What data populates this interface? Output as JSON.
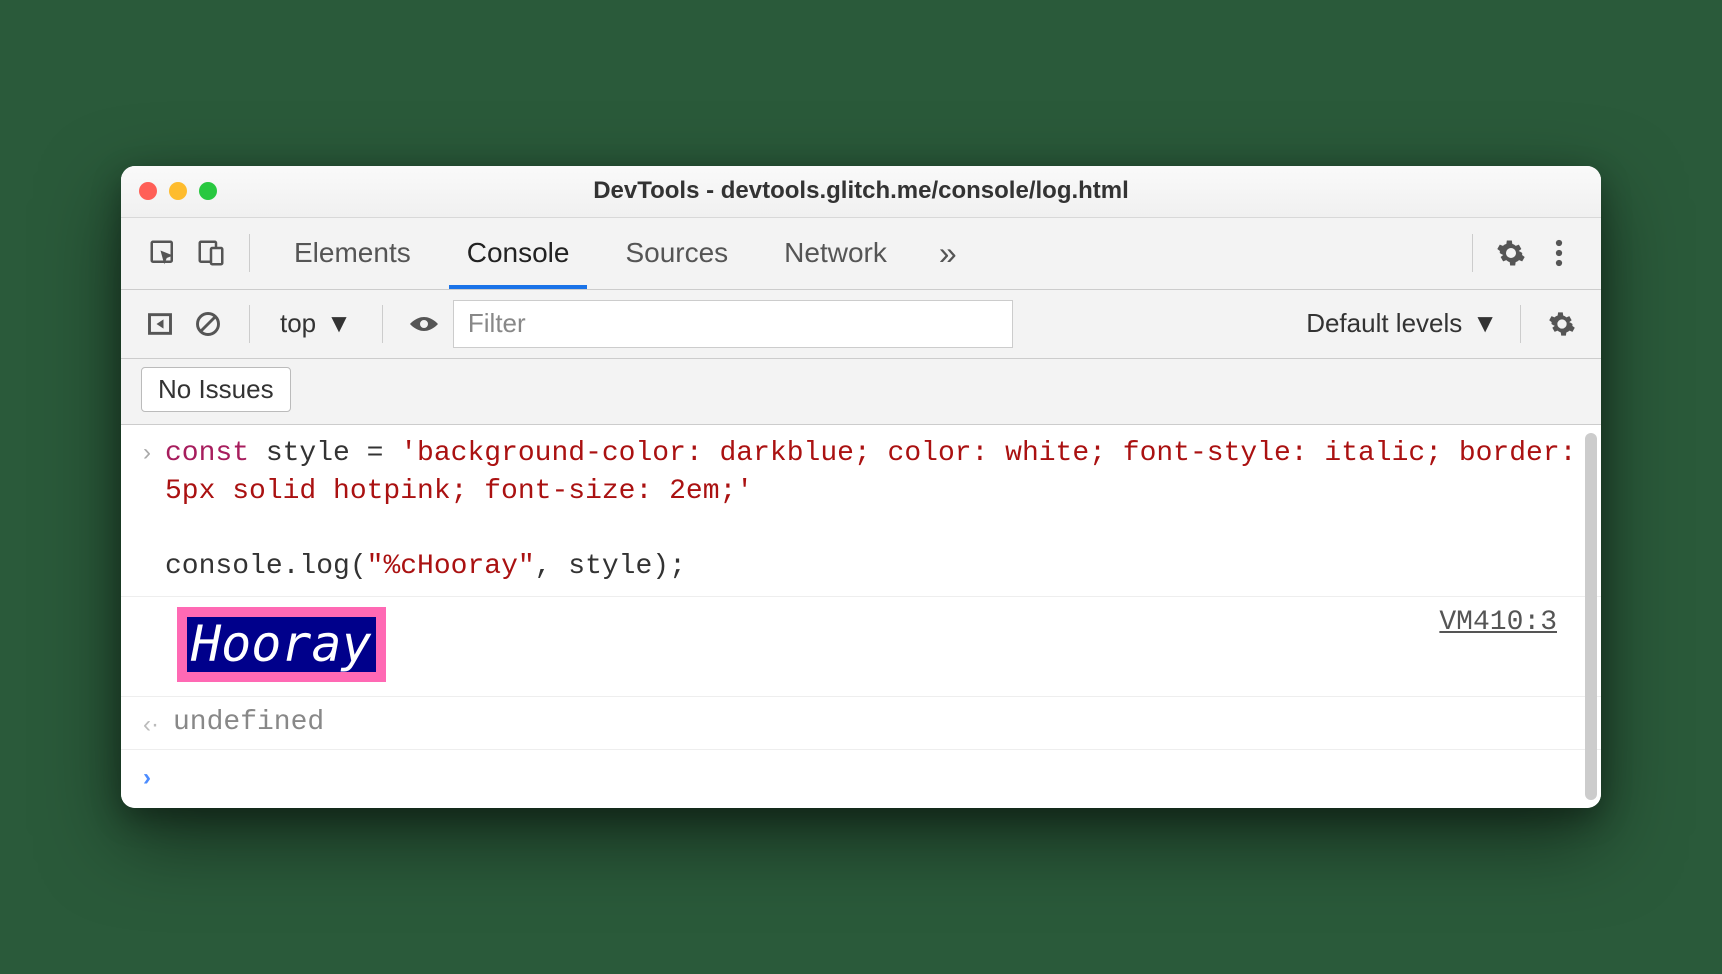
{
  "window": {
    "title": "DevTools - devtools.glitch.me/console/log.html"
  },
  "tabs": {
    "items": [
      "Elements",
      "Console",
      "Sources",
      "Network"
    ],
    "active_index": 1
  },
  "toolbar": {
    "context": "top",
    "filter_placeholder": "Filter",
    "levels": "Default levels"
  },
  "issues": {
    "button": "No Issues"
  },
  "console": {
    "input_code_html": "<span class=\"kw\">const</span><span class=\"plain\"> style = </span><span class=\"str\">'background-color: darkblue; color: white; font-style: italic; border: 5px solid hotpink; font-size: 2em;'</span><span class=\"plain\">\n\nconsole.log(</span><span class=\"str\">\"%cHooray\"</span><span class=\"plain\">, style);</span>",
    "styled_text": "Hooray",
    "source_ref": "VM410:3",
    "return_value": "undefined"
  }
}
